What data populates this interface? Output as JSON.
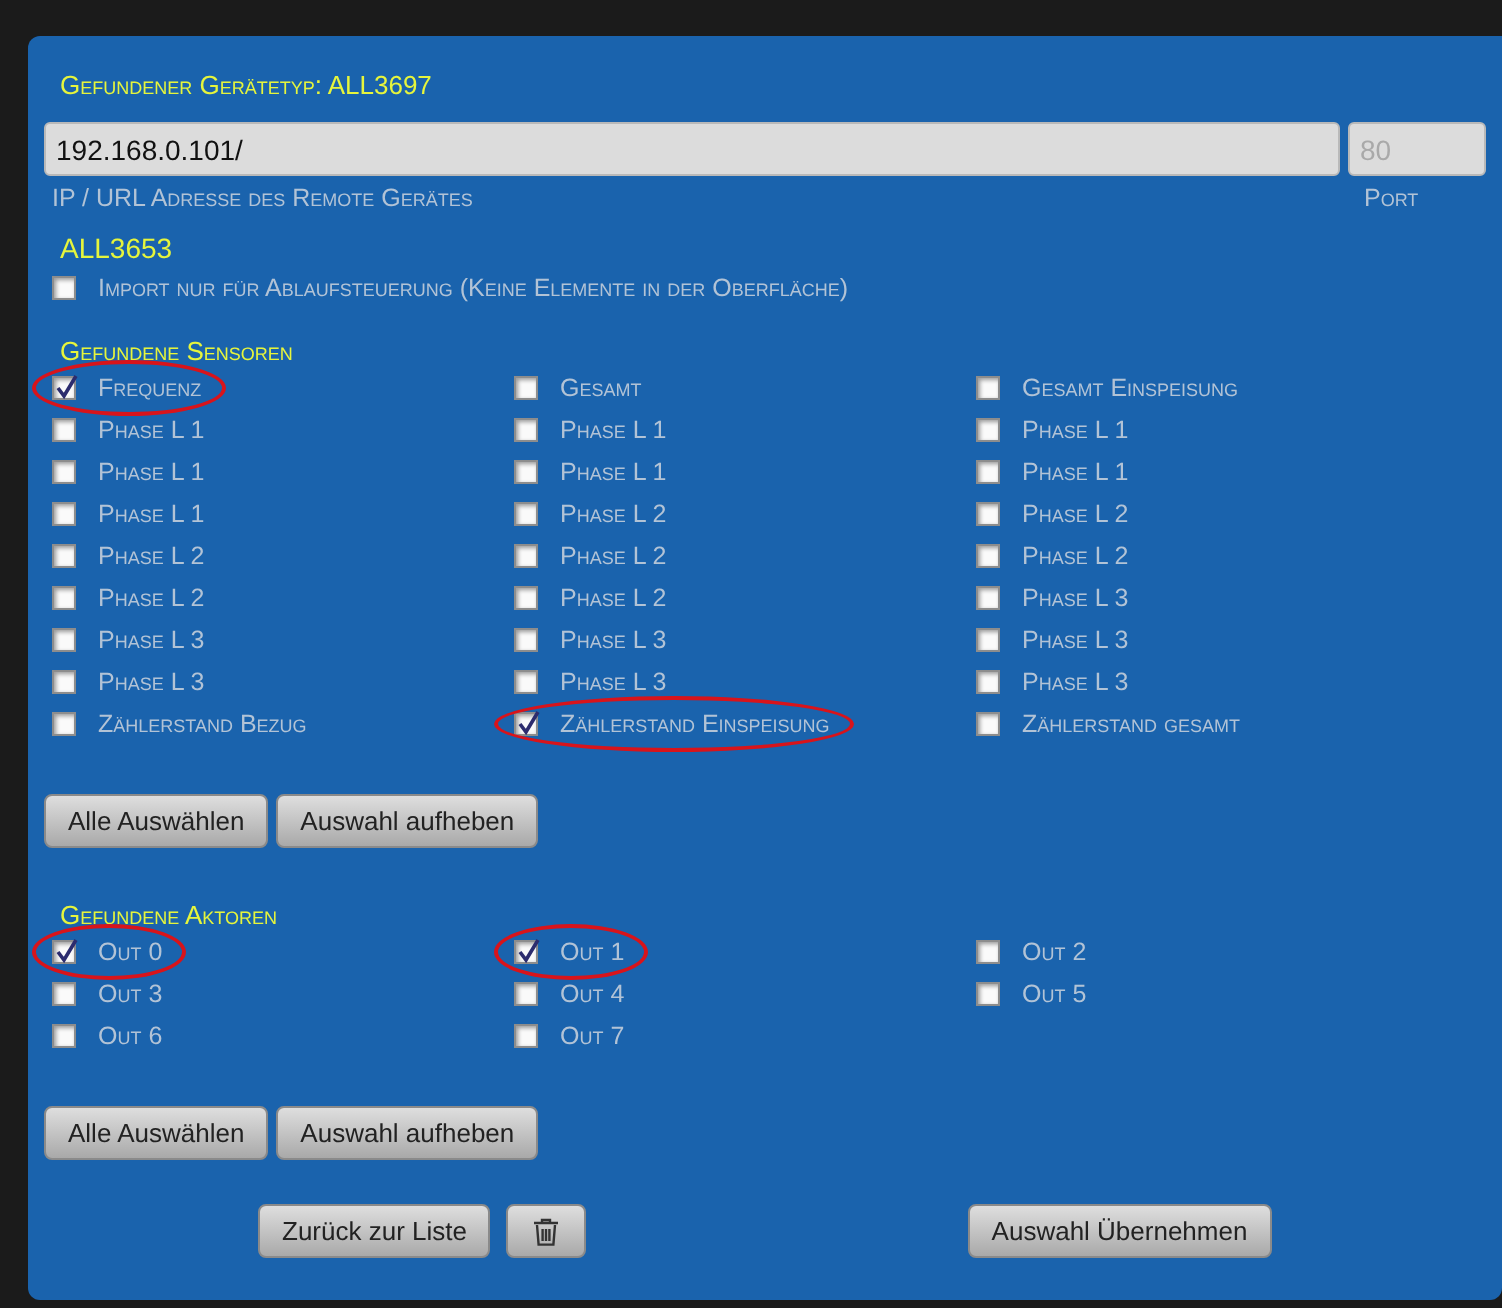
{
  "device_type": "Gefundener Gerätetyp: ALL3697",
  "address": {
    "value": "192.168.0.101/",
    "help": "IP / URL Adresse des Remote Gerätes"
  },
  "port": {
    "placeholder": "80",
    "help": "Port"
  },
  "device_name": "ALL3653",
  "import_option": {
    "label": "Import nur für Ablaufsteuerung (Keine Elemente in der Oberfläche)",
    "checked": false
  },
  "sensors": {
    "title": "Gefundene Sensoren",
    "items": [
      {
        "label": "Frequenz",
        "checked": true,
        "highlighted": true
      },
      {
        "label": "Gesamt",
        "checked": false,
        "highlighted": false
      },
      {
        "label": "Gesamt Einspeisung",
        "checked": false,
        "highlighted": false
      },
      {
        "label": "Phase L 1",
        "checked": false,
        "highlighted": false
      },
      {
        "label": "Phase L 1",
        "checked": false,
        "highlighted": false
      },
      {
        "label": "Phase L 1",
        "checked": false,
        "highlighted": false
      },
      {
        "label": "Phase L 1",
        "checked": false,
        "highlighted": false
      },
      {
        "label": "Phase L 1",
        "checked": false,
        "highlighted": false
      },
      {
        "label": "Phase L 1",
        "checked": false,
        "highlighted": false
      },
      {
        "label": "Phase L 1",
        "checked": false,
        "highlighted": false
      },
      {
        "label": "Phase L 2",
        "checked": false,
        "highlighted": false
      },
      {
        "label": "Phase L 2",
        "checked": false,
        "highlighted": false
      },
      {
        "label": "Phase L 2",
        "checked": false,
        "highlighted": false
      },
      {
        "label": "Phase L 2",
        "checked": false,
        "highlighted": false
      },
      {
        "label": "Phase L 2",
        "checked": false,
        "highlighted": false
      },
      {
        "label": "Phase L 2",
        "checked": false,
        "highlighted": false
      },
      {
        "label": "Phase L 2",
        "checked": false,
        "highlighted": false
      },
      {
        "label": "Phase L 3",
        "checked": false,
        "highlighted": false
      },
      {
        "label": "Phase L 3",
        "checked": false,
        "highlighted": false
      },
      {
        "label": "Phase L 3",
        "checked": false,
        "highlighted": false
      },
      {
        "label": "Phase L 3",
        "checked": false,
        "highlighted": false
      },
      {
        "label": "Phase L 3",
        "checked": false,
        "highlighted": false
      },
      {
        "label": "Phase L 3",
        "checked": false,
        "highlighted": false
      },
      {
        "label": "Phase L 3",
        "checked": false,
        "highlighted": false
      },
      {
        "label": "Zählerstand Bezug",
        "checked": false,
        "highlighted": false
      },
      {
        "label": "Zählerstand Einspeisung",
        "checked": true,
        "highlighted": true
      },
      {
        "label": "Zählerstand gesamt",
        "checked": false,
        "highlighted": false
      }
    ],
    "buttons": [
      "Alle Auswählen",
      "Auswahl aufheben"
    ]
  },
  "actors": {
    "title": "Gefundene Aktoren",
    "items": [
      {
        "label": "Out 0",
        "checked": true,
        "highlighted": true
      },
      {
        "label": "Out 1",
        "checked": true,
        "highlighted": true
      },
      {
        "label": "Out 2",
        "checked": false,
        "highlighted": false
      },
      {
        "label": "Out 3",
        "checked": false,
        "highlighted": false
      },
      {
        "label": "Out 4",
        "checked": false,
        "highlighted": false
      },
      {
        "label": "Out 5",
        "checked": false,
        "highlighted": false
      },
      {
        "label": "Out 6",
        "checked": false,
        "highlighted": false
      },
      {
        "label": "Out 7",
        "checked": false,
        "highlighted": false
      }
    ],
    "buttons": [
      "Alle Auswählen",
      "Auswahl aufheben"
    ]
  },
  "footer": {
    "back_button": "Zurück zur Liste",
    "apply_button": "Auswahl Übernehmen"
  }
}
